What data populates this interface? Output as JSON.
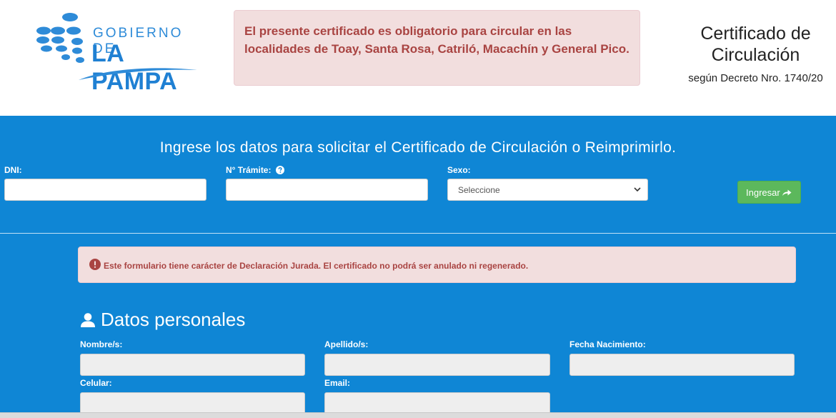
{
  "header": {
    "logo": {
      "line1": "GOBIERNO DE",
      "line2": "LA PAMPA"
    },
    "notice": "El presente certificado es obligatorio para circular en las localidades de Toay, Santa Rosa, Catriló, Macachín y General Pico.",
    "cert_title": "Certificado de Circulación",
    "cert_subtitle": "según Decreto Nro. 1740/20"
  },
  "search_form": {
    "lead": "Ingrese los datos para solicitar el Certificado de Circulación o Reimprimirlo.",
    "dni_label": "DNI:",
    "dni_value": "",
    "tramite_label": "N° Trámite:",
    "tramite_value": "",
    "sexo_label": "Sexo:",
    "sexo_selected": "Seleccione",
    "submit_label": "Ingresar",
    "icons": {
      "tramite_help": "question-circle-icon",
      "submit": "share-arrow-icon",
      "select": "chevron-down-icon"
    }
  },
  "declaration_alert": {
    "text": "Este formulario tiene carácter de Declaración Jurada. El certificado no podrá ser anulado ni regenerado.",
    "icon": "exclamation-circle-icon"
  },
  "personal_data": {
    "title": "Datos personales",
    "icon": "user-icon",
    "nombre_label": "Nombre/s:",
    "apellido_label": "Apellido/s:",
    "fecha_label": "Fecha Nacimiento:",
    "celular_label": "Celular:",
    "email_label": "Email:"
  },
  "colors": {
    "brand_blue": "#0f86d5",
    "alert_bg": "#f2dede",
    "alert_text": "#a94442",
    "success": "#5cb85c"
  }
}
